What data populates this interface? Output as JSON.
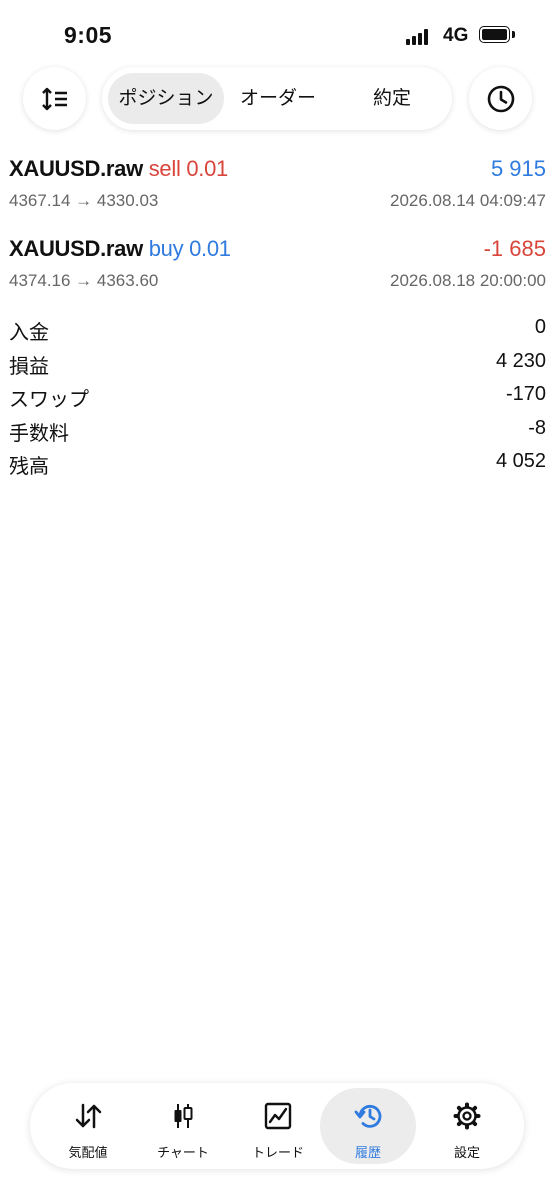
{
  "status": {
    "time": "9:05",
    "network": "4G"
  },
  "toolbar": {
    "sort_icon": "sort-icon",
    "history_icon": "clock-icon",
    "segments": [
      {
        "label": "ポジション",
        "active": true
      },
      {
        "label": "オーダー",
        "active": false
      },
      {
        "label": "約定",
        "active": false
      }
    ]
  },
  "trades": [
    {
      "symbol": "XAUUSD.raw",
      "direction": "sell 0.01",
      "profit": "5 915",
      "prices": "4367.14 → 4330.03",
      "datetime": "2026.08.14 04:09:47"
    },
    {
      "symbol": "XAUUSD.raw",
      "direction": "buy 0.01",
      "profit": "-1 685",
      "prices": "4374.16 → 4363.60",
      "datetime": "2026.08.18 20:00:00"
    }
  ],
  "summary": [
    {
      "label": "入金",
      "value": "0"
    },
    {
      "label": "損益",
      "value": "4 230"
    },
    {
      "label": "スワップ",
      "value": "-170"
    },
    {
      "label": "手数料",
      "value": "-8"
    },
    {
      "label": "残高",
      "value": "4 052"
    }
  ],
  "tabs": [
    {
      "label": "気配値",
      "icon": "quotes-arrows-icon",
      "active": false
    },
    {
      "label": "チャート",
      "icon": "candlestick-icon",
      "active": false
    },
    {
      "label": "トレード",
      "icon": "trade-chart-icon",
      "active": false
    },
    {
      "label": "履歴",
      "icon": "history-icon",
      "active": true
    },
    {
      "label": "設定",
      "icon": "gear-icon",
      "active": false
    }
  ],
  "colors": {
    "sell": "#d9453b",
    "buy": "#2f7be0",
    "active_tab": "#2f7be0"
  }
}
